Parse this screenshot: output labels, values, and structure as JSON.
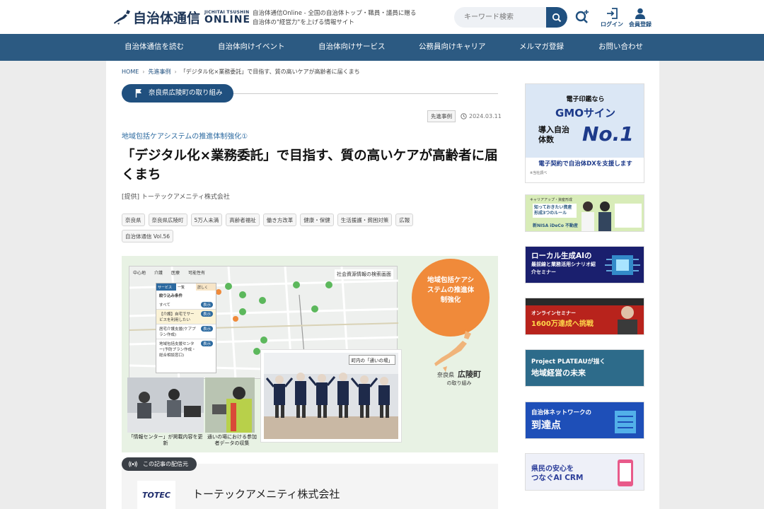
{
  "header": {
    "logo_main": "自治体通信",
    "logo_sub_top": "JICHITAI TSUSHIN",
    "logo_sub_bot": "ONLINE",
    "tagline_line1": "自治体通信Online - 全国の自治体トップ・職員・議員に贈る",
    "tagline_line2": "自治体の\"経営力\"を上げる情報サイト",
    "search_placeholder": "キーワード検索",
    "login_label": "ログイン",
    "register_label": "会員登録"
  },
  "nav": {
    "items": [
      "自治体通信を読む",
      "自治体向けイベント",
      "自治体向けサービス",
      "公務員向けキャリア",
      "メルマガ登録",
      "お問い合わせ"
    ]
  },
  "breadcrumb": {
    "home": "HOME",
    "category": "先進事例",
    "current": "「デジタル化×業務委託」で目指す、質の高いケアが高齢者に届くまち"
  },
  "article": {
    "region": "奈良県広陵町の取り組み",
    "category_badge": "先進事例",
    "date": "2024.03.11",
    "series": "地域包括ケアシステムの推進体制強化①",
    "title": "「デジタル化×業務委託」で目指す、質の高いケアが高齢者に届くまち",
    "provided": "[提供] トーテックアメニティ株式会社",
    "tags": [
      "奈良県",
      "奈良県広陵町",
      "5万人未満",
      "高齢者福祉",
      "働き方改革",
      "健康・保健",
      "生活援護・貧困対策",
      "広報",
      "自治体通信 Vol.56"
    ]
  },
  "hero": {
    "map_tabs": [
      "中心地",
      "介護",
      "医療",
      "可能性有"
    ],
    "map_caption": "社会資源情報の検索画面",
    "filter_title": "絞り込み条件",
    "filter_tabs": [
      "サービス",
      "一覧",
      "詳しく"
    ],
    "filter_rows": [
      "すべて",
      "【介護】自宅でサービスを利用したい",
      "居宅介護支援(ケアプラン作成)",
      "地域包括支援センター(予防プラン作成・総合相談窓口)"
    ],
    "toggle_label": "表示",
    "circle_text": "地域包括ケアシステムの推進体制強化",
    "place_small": "奈良県",
    "place_big": "広陵町",
    "place_sub": "の取り組み",
    "photo_caption": "町内の「通いの場」",
    "caption1": "「情報センター」が掲載内容を更新",
    "caption2": "通いの場における参加者データの収集"
  },
  "source": {
    "label": "この記事の配信元",
    "logo_text": "TOTEC",
    "name": "トーテックアメニティ株式会社"
  },
  "ads": [
    {
      "small": "電子印鑑なら",
      "brand": "GMOサイン",
      "line": "導入自治体数",
      "big": "No.1",
      "bottom": "電子契約で自治体DXを支援します",
      "note": "※当社調べ"
    },
    {
      "small": "キャリアアップ・資産形成",
      "main": "知っておきたい資産形成3つのルール",
      "sub": "新NISA iDeCo 不動産"
    },
    {
      "main": "ローカル生成AIの",
      "sub": "最前線と業務活用シナリオ紹介セミナー"
    },
    {
      "main": "1600万達成へ挑戦",
      "sub": "オンラインセミナー"
    },
    {
      "main": "Project PLATEAUが描く",
      "sub": "地域経営の未来"
    },
    {
      "main": "自治体ネットワークの",
      "sub": "到達点"
    },
    {
      "main": "県民の安心を",
      "sub": "つなぐAI CRM"
    }
  ],
  "colors": {
    "navy": "#2c5a82",
    "dark_navy": "#20507f",
    "series_blue": "#2c6aa0",
    "orange": "#f08a3a",
    "map_green": "#5cb85c"
  }
}
